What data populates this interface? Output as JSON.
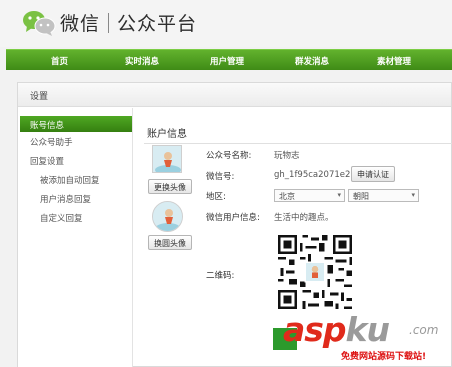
{
  "header": {
    "brand_wechat": "微信",
    "brand_platform": "公众平台"
  },
  "nav": [
    "首页",
    "实时消息",
    "用户管理",
    "群发消息",
    "素材管理"
  ],
  "panel": {
    "title": "设置"
  },
  "sidebar": {
    "items": [
      {
        "label": "账号信息",
        "active": true
      },
      {
        "label": "公众号助手"
      },
      {
        "label": "回复设置"
      },
      {
        "label": "被添加自动回复"
      },
      {
        "label": "用户消息回复"
      },
      {
        "label": "自定义回复"
      }
    ]
  },
  "account": {
    "section_title": "账户信息",
    "change_avatar": "更换头像",
    "change_round_avatar": "换圆头像",
    "name_label": "公众号名称:",
    "name_value": "玩物志",
    "wechat_id_label": "微信号:",
    "wechat_id_value": "gh_1f95ca2071e2",
    "verify_button": "申请认证",
    "region_label": "地区:",
    "province": "北京",
    "city": "朝阳",
    "interest_label": "微信用户信息:",
    "interest_value": "生活中的趣点。",
    "qrcode_label": "二维码:"
  },
  "watermark": {
    "main": "asp",
    "ku": "ku",
    "com": ".com",
    "sub": "免费网站源码下载站!"
  },
  "colors": {
    "nav_green": "#4a9a1f",
    "accent_red": "#e02a1b"
  }
}
